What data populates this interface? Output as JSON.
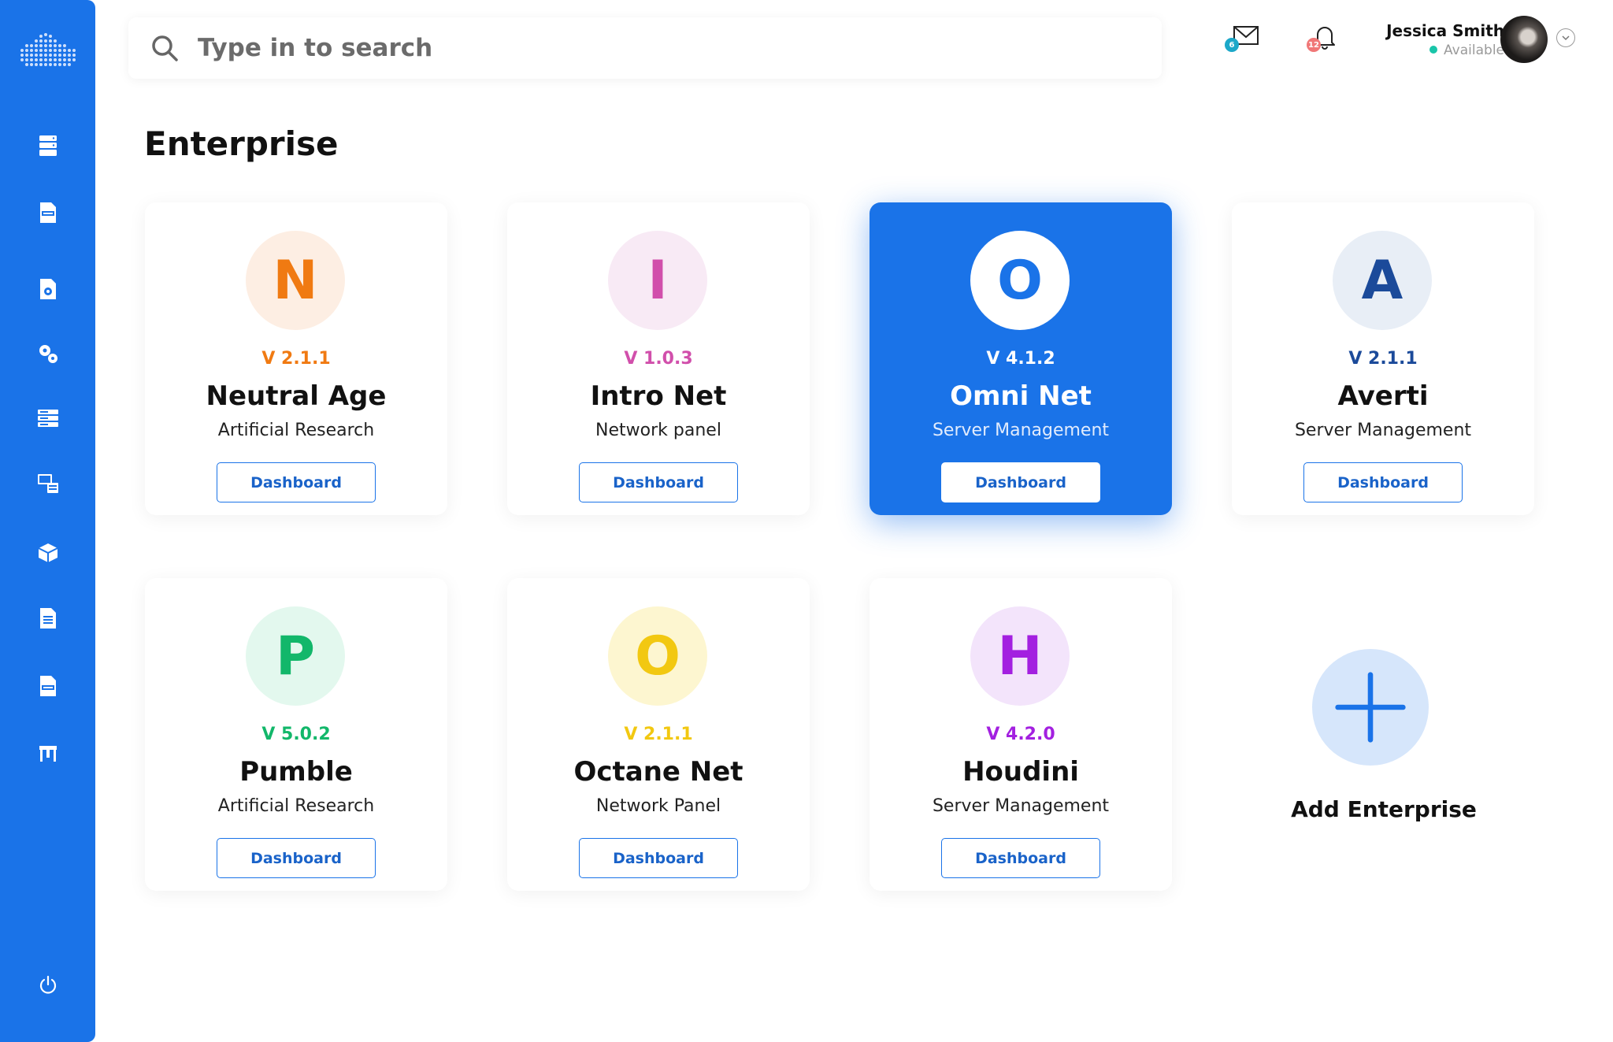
{
  "search": {
    "placeholder": "Type in to search"
  },
  "header": {
    "mail_count": "6",
    "notification_count": "12",
    "user_name": "Jessica Smith",
    "user_status": "Available"
  },
  "sidebar": {
    "items": [
      {
        "icon": "vpn-server-icon"
      },
      {
        "icon": "vpn-document-icon"
      },
      {
        "icon": "file-settings-icon"
      },
      {
        "icon": "gears-icon"
      },
      {
        "icon": "server-stack-icon"
      },
      {
        "icon": "monitor-devices-icon"
      },
      {
        "icon": "network-box-icon"
      },
      {
        "icon": "report-file-icon"
      },
      {
        "icon": "bgp-file-icon"
      },
      {
        "icon": "gateway-icon"
      }
    ],
    "footer_icon": "power-icon"
  },
  "page": {
    "title": "Enterprise"
  },
  "cards": [
    {
      "letter": "N",
      "version": "V 2.1.1",
      "name": "Neutral Age",
      "subtitle": "Artificial Research",
      "button": "Dashboard",
      "accent": "#f07a12",
      "bg": "#fdeee3"
    },
    {
      "letter": "I",
      "version": "V 1.0.3",
      "name": "Intro Net",
      "subtitle": "Network panel",
      "button": "Dashboard",
      "accent": "#d14fab",
      "bg": "#f8eaf5"
    },
    {
      "letter": "O",
      "version": "V 4.1.2",
      "name": "Omni Net",
      "subtitle": "Server Management",
      "button": "Dashboard",
      "accent": "#1a73e8",
      "bg": "#ffffff",
      "active": true
    },
    {
      "letter": "A",
      "version": "V 2.1.1",
      "name": "Averti",
      "subtitle": "Server Management",
      "button": "Dashboard",
      "accent": "#1b4a9a",
      "bg": "#e8eef6"
    },
    {
      "letter": "P",
      "version": "V 5.0.2",
      "name": "Pumble",
      "subtitle": "Artificial Research",
      "button": "Dashboard",
      "accent": "#12b76a",
      "bg": "#e3f8ee"
    },
    {
      "letter": "O",
      "version": "V 2.1.1",
      "name": "Octane Net",
      "subtitle": "Network Panel",
      "button": "Dashboard",
      "accent": "#f2c811",
      "bg": "#fdf6d0"
    },
    {
      "letter": "H",
      "version": "V 4.2.0",
      "name": "Houdini",
      "subtitle": "Server Management",
      "button": "Dashboard",
      "accent": "#a320e0",
      "bg": "#f3e4fb"
    }
  ],
  "add": {
    "label": "Add Enterprise"
  },
  "colors": {
    "primary": "#1a73e8",
    "status_online": "#19c5a9",
    "mail_badge": "#1ca8c9",
    "notif_badge": "#f07777"
  }
}
